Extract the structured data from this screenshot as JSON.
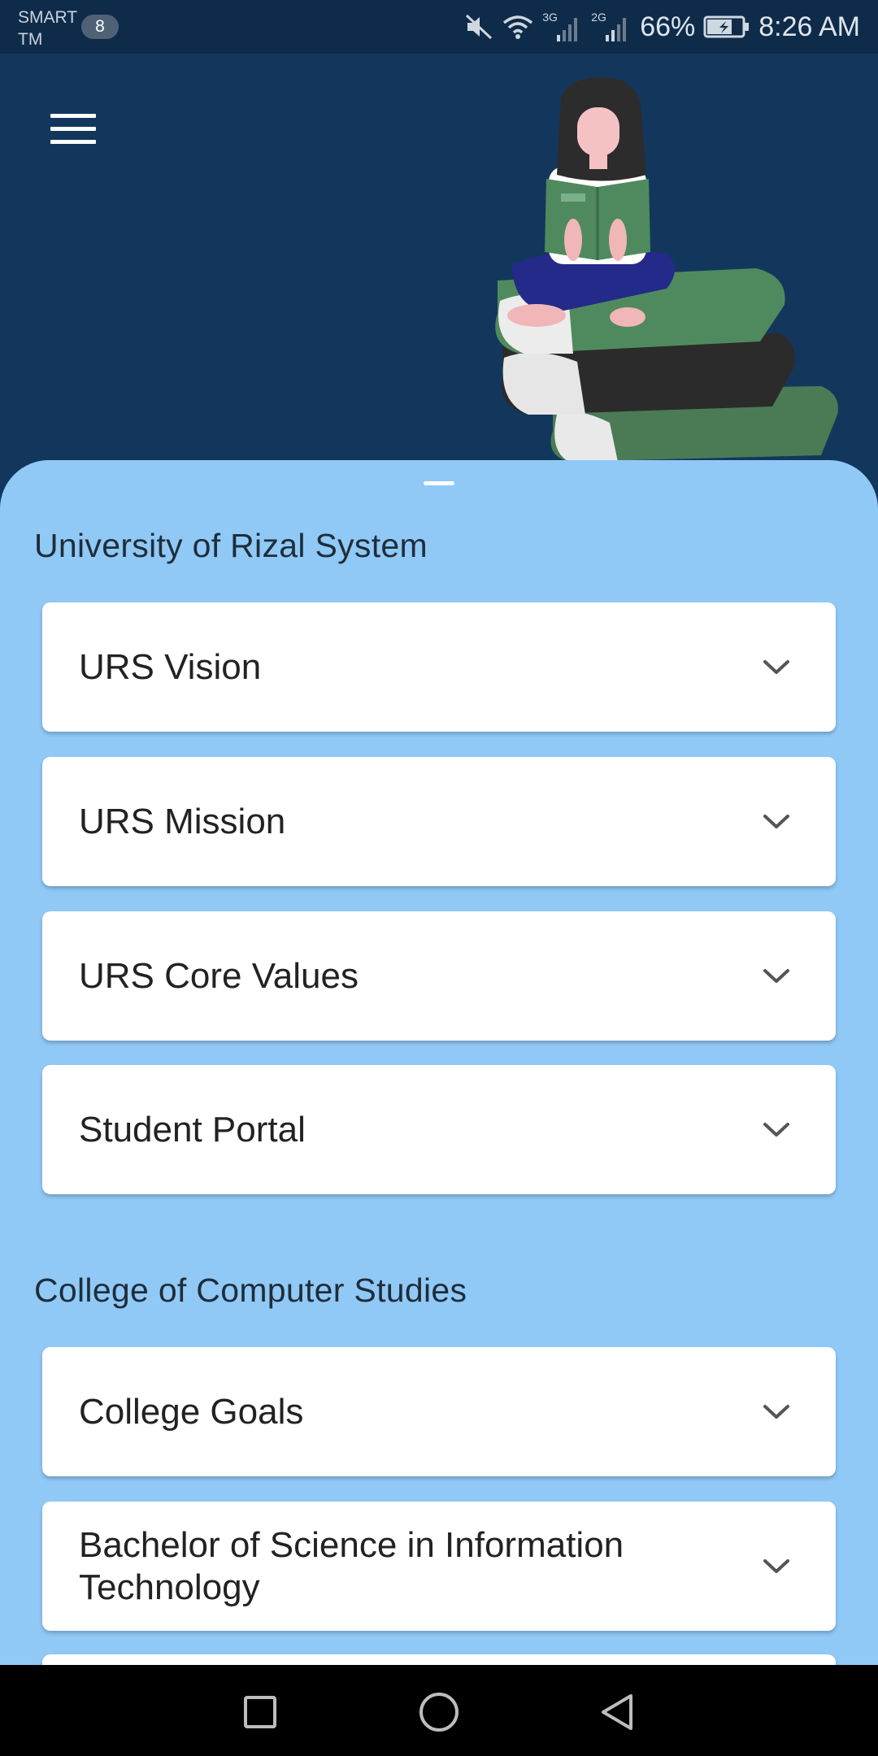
{
  "status_bar": {
    "carrier_line1": "SMART",
    "carrier_line2": "TM",
    "notification_count": "8",
    "network_3g": "3G",
    "network_2g": "2G",
    "battery": "66%",
    "time": "8:26 AM",
    "icons": [
      "mute-icon",
      "wifi-icon",
      "signal-icon",
      "signal-icon",
      "battery-charging-icon"
    ]
  },
  "header": {
    "menu_icon": "hamburger-menu-icon",
    "illustration": "girl-reading-on-books"
  },
  "sections": [
    {
      "title": "University of Rizal System",
      "items": [
        {
          "label": "URS Vision"
        },
        {
          "label": "URS Mission"
        },
        {
          "label": "URS Core Values"
        },
        {
          "label": "Student Portal"
        }
      ]
    },
    {
      "title": "College of Computer Studies",
      "items": [
        {
          "label": "College Goals"
        },
        {
          "label": "Bachelor of Science in Information Technology"
        }
      ]
    }
  ],
  "nav_bar": {
    "icons": [
      "recent-apps-icon",
      "home-icon",
      "back-icon"
    ]
  },
  "colors": {
    "header_bg": "#13375c",
    "sheet_bg": "#90c9f6",
    "card_bg": "#ffffff",
    "status_bg": "#0f2b4a"
  }
}
